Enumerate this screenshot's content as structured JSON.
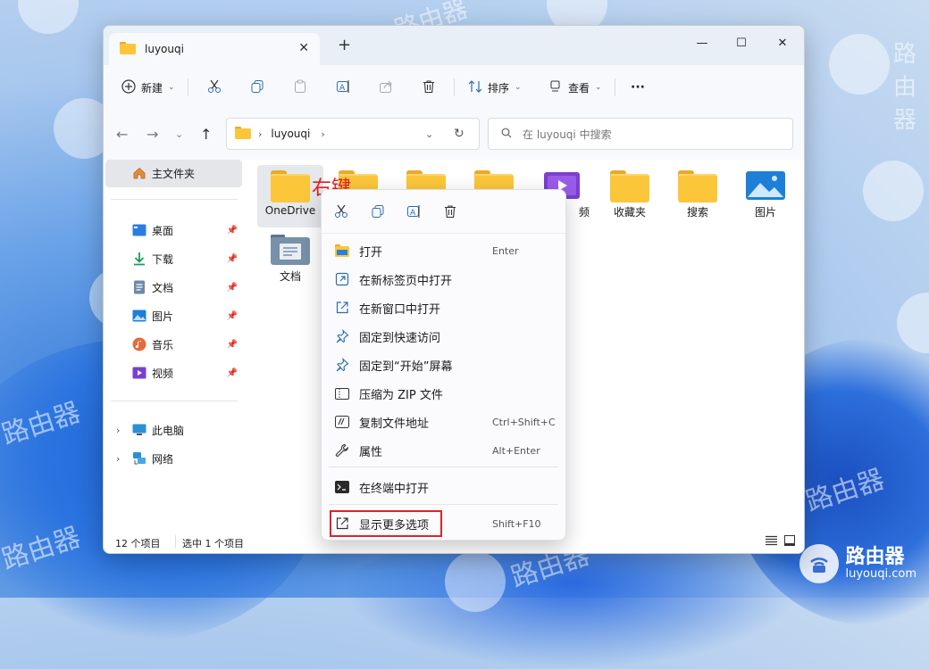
{
  "window": {
    "tab_title": "luyouqi",
    "new_tab": "+",
    "minimize": "—",
    "maximize": "☐",
    "close": "✕"
  },
  "toolbar": {
    "new_label": "新建",
    "sort_label": "排序",
    "view_label": "查看",
    "more_label": "···"
  },
  "address": {
    "path": "luyouqi",
    "search_placeholder": "在 luyouqi 中搜索"
  },
  "sidebar": {
    "home": "主文件夹",
    "quick": [
      "桌面",
      "下载",
      "文档",
      "图片",
      "音乐",
      "视频"
    ],
    "this_pc": "此电脑",
    "network": "网络"
  },
  "files": {
    "onedrive": "OneDrive",
    "videos_partial": "频",
    "favorites": "收藏夹",
    "searches": "搜索",
    "pictures": "图片",
    "documents": "文档"
  },
  "status": {
    "count": "12 个项目",
    "selected": "选中 1 个项目"
  },
  "annotation": "右键",
  "context_menu": {
    "items": [
      {
        "label": "打开",
        "shortcut": "Enter"
      },
      {
        "label": "在新标签页中打开",
        "shortcut": ""
      },
      {
        "label": "在新窗口中打开",
        "shortcut": ""
      },
      {
        "label": "固定到快速访问",
        "shortcut": ""
      },
      {
        "label": "固定到“开始”屏幕",
        "shortcut": ""
      },
      {
        "label": "压缩为 ZIP 文件",
        "shortcut": ""
      },
      {
        "label": "复制文件地址",
        "shortcut": "Ctrl+Shift+C"
      },
      {
        "label": "属性",
        "shortcut": "Alt+Enter"
      },
      {
        "label": "在终端中打开",
        "shortcut": ""
      },
      {
        "label": "显示更多选项",
        "shortcut": "Shift+F10"
      }
    ]
  },
  "watermark": {
    "cn": "路由器",
    "en": "luyouqi.com"
  },
  "colors": {
    "folder": "#fcc63a",
    "accent": "#005fb8",
    "highlight_box": "#d7262b",
    "annotation": "#e02020"
  }
}
